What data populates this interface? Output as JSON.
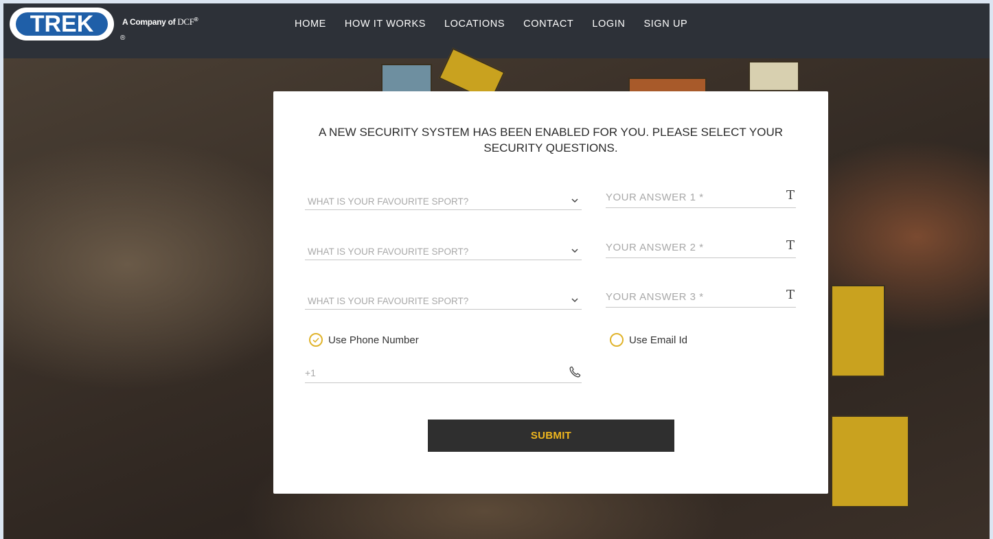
{
  "header": {
    "logo_text": "TREK",
    "company_text": "A Company of",
    "company_brand": "DCF",
    "registered_mark": "®",
    "nav": [
      "HOME",
      "HOW IT WORKS",
      "LOCATIONS",
      "CONTACT",
      "LOGIN",
      "SIGN UP"
    ]
  },
  "form": {
    "title": "A NEW SECURITY SYSTEM HAS BEEN ENABLED FOR YOU. PLEASE SELECT YOUR SECURITY QUESTIONS.",
    "questions": [
      {
        "select_value": "WHAT IS YOUR FAVOURITE SPORT?",
        "answer_placeholder": "YOUR ANSWER 1 *"
      },
      {
        "select_value": "WHAT IS YOUR FAVOURITE SPORT?",
        "answer_placeholder": "YOUR ANSWER 2 *"
      },
      {
        "select_value": "WHAT IS YOUR FAVOURITE SPORT?",
        "answer_placeholder": "YOUR ANSWER 3 *"
      }
    ],
    "text_icon_glyph": "T",
    "options": {
      "phone_label": "Use Phone Number",
      "email_label": "Use Email Id",
      "selected": "phone"
    },
    "phone_placeholder": "+1",
    "submit_label": "SUBMIT"
  },
  "colors": {
    "accent": "#e0b32a",
    "submit_text": "#f0b71e",
    "header_bg": "#2d3138",
    "submit_bg": "#2f2f2f"
  }
}
